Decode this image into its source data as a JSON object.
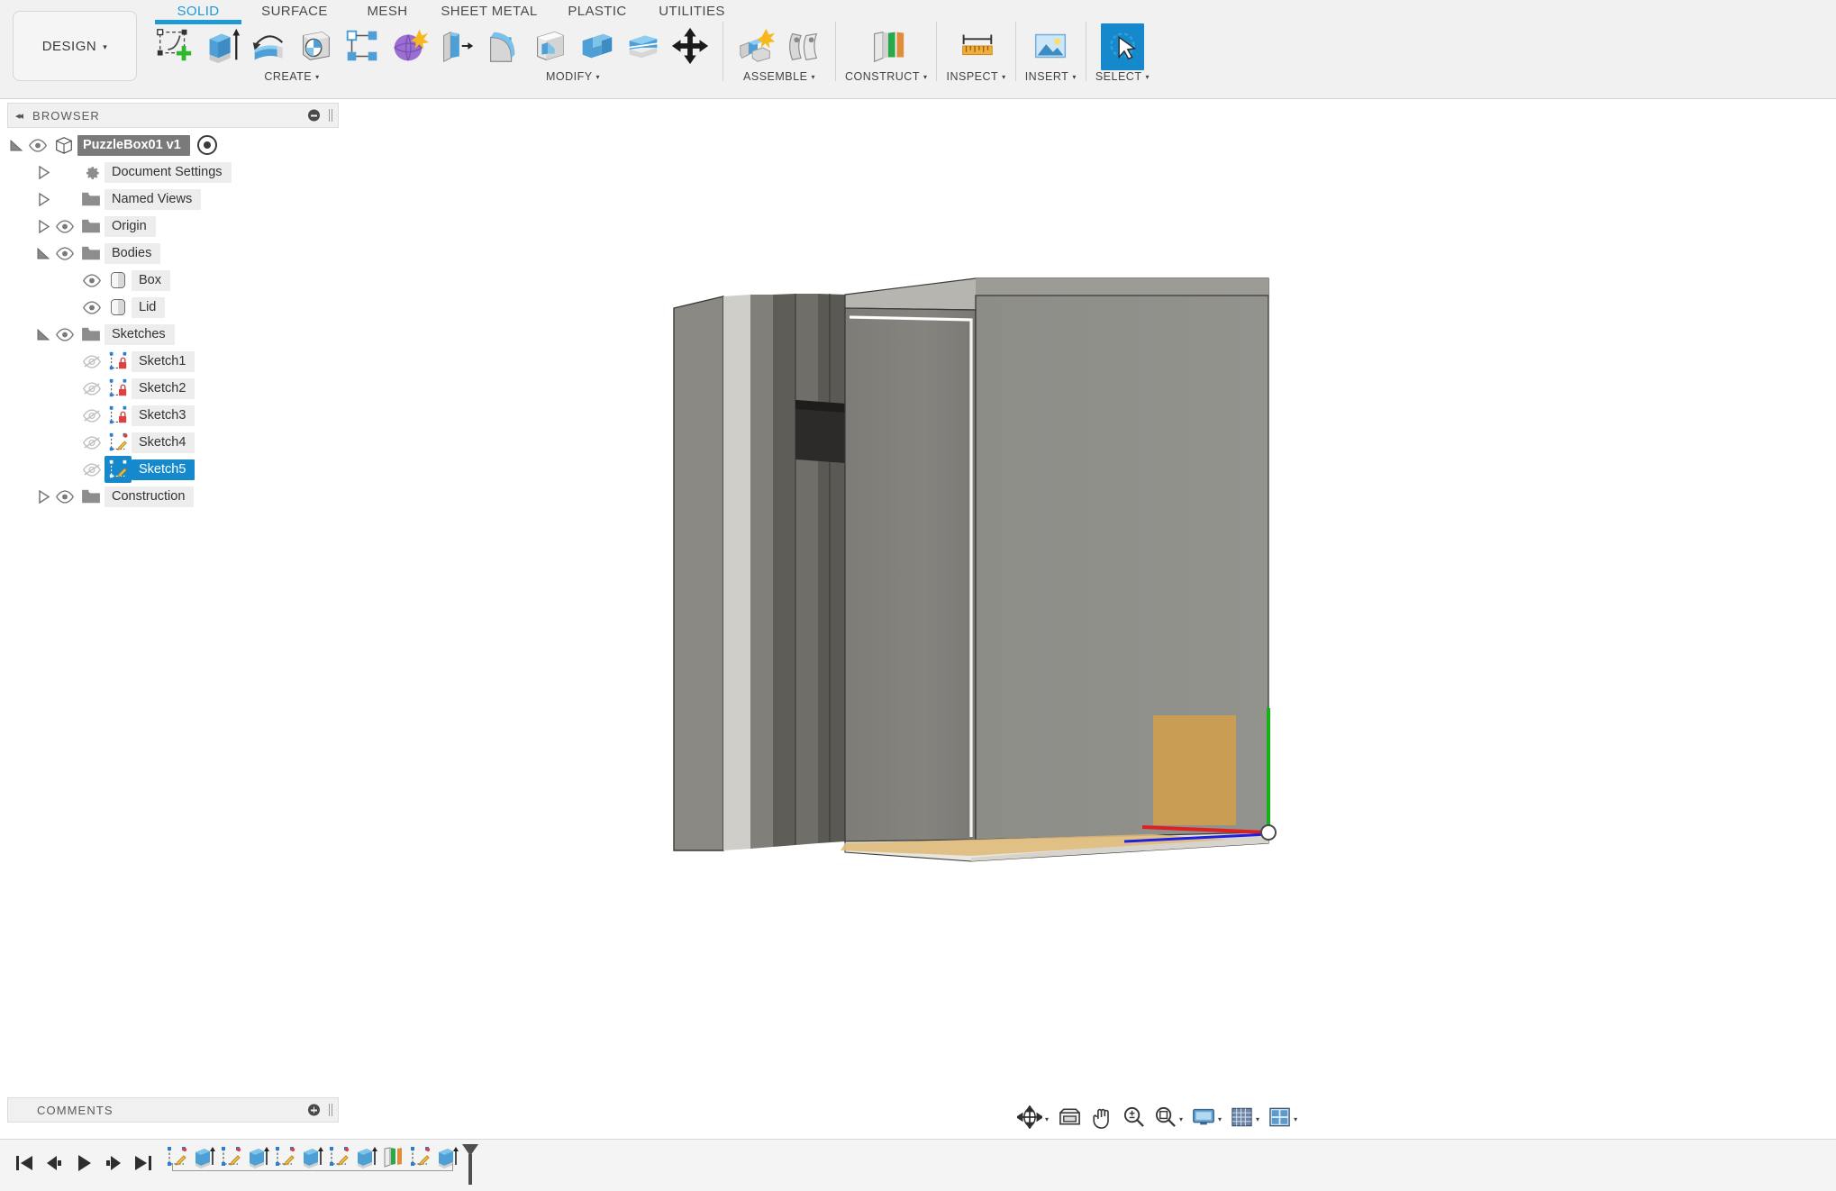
{
  "app": {
    "workspace_label": "DESIGN",
    "caret": "▾"
  },
  "ribbon": {
    "tabs": [
      {
        "label": "SOLID",
        "active": true
      },
      {
        "label": "SURFACE",
        "active": false
      },
      {
        "label": "MESH",
        "active": false
      },
      {
        "label": "SHEET METAL",
        "active": false
      },
      {
        "label": "PLASTIC",
        "active": false
      },
      {
        "label": "UTILITIES",
        "active": false
      }
    ],
    "groups": [
      {
        "label": "CREATE",
        "has_caret": true,
        "tools": [
          {
            "name": "create-sketch-icon",
            "title": "Create Sketch"
          },
          {
            "name": "extrude-icon",
            "title": "Extrude"
          },
          {
            "name": "revolve-icon",
            "title": "Revolve"
          },
          {
            "name": "sweep-icon",
            "title": "Sweep"
          },
          {
            "name": "pattern-icon",
            "title": "Pattern"
          },
          {
            "name": "form-icon",
            "title": "Create Form"
          }
        ]
      },
      {
        "label": "MODIFY",
        "has_caret": true,
        "tools": [
          {
            "name": "press-pull-icon",
            "title": "Press Pull"
          },
          {
            "name": "fillet-icon",
            "title": "Fillet"
          },
          {
            "name": "shell-icon",
            "title": "Shell"
          },
          {
            "name": "combine-icon",
            "title": "Combine"
          },
          {
            "name": "split-face-icon",
            "title": "Split Face"
          },
          {
            "name": "move-copy-icon",
            "title": "Move/Copy"
          }
        ]
      },
      {
        "label": "ASSEMBLE",
        "has_caret": true,
        "tools": [
          {
            "name": "new-component-icon",
            "title": "New Component"
          },
          {
            "name": "joint-icon",
            "title": "Joint"
          }
        ]
      },
      {
        "label": "CONSTRUCT",
        "has_caret": true,
        "tools": [
          {
            "name": "offset-plane-icon",
            "title": "Offset Plane"
          }
        ]
      },
      {
        "label": "INSPECT",
        "has_caret": true,
        "tools": [
          {
            "name": "measure-icon",
            "title": "Measure"
          }
        ]
      },
      {
        "label": "INSERT",
        "has_caret": true,
        "tools": [
          {
            "name": "insert-image-icon",
            "title": "Canvas"
          }
        ]
      },
      {
        "label": "SELECT",
        "has_caret": true,
        "tools": [
          {
            "name": "select-cursor-icon",
            "title": "Select",
            "selected": true
          }
        ]
      }
    ]
  },
  "browser": {
    "panel_title": "BROWSER",
    "collapse_icon": "◂◂",
    "tree": [
      {
        "label": "PuzzleBox01 v1",
        "level": 0,
        "type": "root",
        "arrow": "expanded",
        "eye": true,
        "icon": "component-icon",
        "radio": true
      },
      {
        "label": "Document Settings",
        "level": 1,
        "type": "settings",
        "arrow": "collapsed",
        "eye": false,
        "icon": "gear-icon"
      },
      {
        "label": "Named Views",
        "level": 1,
        "type": "folder",
        "arrow": "collapsed",
        "eye": false,
        "icon": "folder-icon"
      },
      {
        "label": "Origin",
        "level": 1,
        "type": "folder",
        "arrow": "collapsed",
        "eye": true,
        "icon": "folder-icon"
      },
      {
        "label": "Bodies",
        "level": 1,
        "type": "folder",
        "arrow": "expanded",
        "eye": true,
        "icon": "folder-icon"
      },
      {
        "label": "Box",
        "level": 2,
        "type": "body",
        "arrow": "none",
        "eye": true,
        "icon": "body-icon"
      },
      {
        "label": "Lid",
        "level": 2,
        "type": "body",
        "arrow": "none",
        "eye": true,
        "icon": "body-icon"
      },
      {
        "label": "Sketches",
        "level": 1,
        "type": "folder",
        "arrow": "expanded",
        "eye": true,
        "icon": "folder-icon"
      },
      {
        "label": "Sketch1",
        "level": 2,
        "type": "sketch",
        "arrow": "none",
        "eye": "hidden",
        "icon": "sketch-locked-icon"
      },
      {
        "label": "Sketch2",
        "level": 2,
        "type": "sketch",
        "arrow": "none",
        "eye": "hidden",
        "icon": "sketch-locked-icon"
      },
      {
        "label": "Sketch3",
        "level": 2,
        "type": "sketch",
        "arrow": "none",
        "eye": "hidden",
        "icon": "sketch-locked-icon"
      },
      {
        "label": "Sketch4",
        "level": 2,
        "type": "sketch",
        "arrow": "none",
        "eye": "hidden",
        "icon": "sketch-icon"
      },
      {
        "label": "Sketch5",
        "level": 2,
        "type": "sketch",
        "arrow": "none",
        "eye": "hidden",
        "icon": "sketch-icon",
        "selected": true
      },
      {
        "label": "Construction",
        "level": 1,
        "type": "folder",
        "arrow": "collapsed",
        "eye": true,
        "icon": "folder-icon"
      }
    ]
  },
  "comments": {
    "title": "COMMENTS"
  },
  "viewbar": {
    "tools": [
      {
        "name": "orbit-icon",
        "title": "Orbit",
        "caret": true
      },
      {
        "name": "look-at-icon",
        "title": "Look At",
        "caret": false
      },
      {
        "name": "pan-icon",
        "title": "Pan",
        "caret": false
      },
      {
        "name": "zoom-icon",
        "title": "Zoom",
        "caret": false
      },
      {
        "name": "zoom-fit-icon",
        "title": "Fit",
        "caret": true
      },
      {
        "name": "display-settings-icon",
        "title": "Display Settings",
        "caret": true
      },
      {
        "name": "grid-snap-icon",
        "title": "Grid and Snaps",
        "caret": true
      },
      {
        "name": "viewports-icon",
        "title": "Viewports",
        "caret": true
      }
    ]
  },
  "timeline": {
    "nav": [
      {
        "name": "timeline-go-start-button",
        "glyph": "start"
      },
      {
        "name": "timeline-step-back-button",
        "glyph": "stepback"
      },
      {
        "name": "timeline-play-button",
        "glyph": "play"
      },
      {
        "name": "timeline-step-forward-button",
        "glyph": "stepfwd"
      },
      {
        "name": "timeline-go-end-button",
        "glyph": "end"
      }
    ],
    "features": [
      {
        "name": "timeline-sketch-feature",
        "icon": "sketch-icon"
      },
      {
        "name": "timeline-extrude-feature",
        "icon": "extrude-icon"
      },
      {
        "name": "timeline-sketch-feature",
        "icon": "sketch-icon"
      },
      {
        "name": "timeline-extrude-feature",
        "icon": "extrude-icon"
      },
      {
        "name": "timeline-sketch-feature",
        "icon": "sketch-icon"
      },
      {
        "name": "timeline-extrude-feature",
        "icon": "extrude-icon"
      },
      {
        "name": "timeline-sketch-feature",
        "icon": "sketch-icon"
      },
      {
        "name": "timeline-extrude-feature",
        "icon": "extrude-icon"
      },
      {
        "name": "timeline-plane-feature",
        "icon": "offset-plane-icon"
      },
      {
        "name": "timeline-sketch-feature",
        "icon": "sketch-icon"
      },
      {
        "name": "timeline-extrude-feature",
        "icon": "extrude-icon"
      }
    ],
    "marker_name": "timeline-playhead-marker"
  },
  "model": {
    "description": "PuzzleBox01 solid body shaded grey with hinge slot on left edge and orange sketch profile at lower right",
    "colors": {
      "body_front": "#82807b",
      "body_right": "#8e8e89",
      "body_top": "#9b9b96",
      "sketch_profile": "#cf9e4f",
      "axis_x": "#e02020",
      "axis_y": "#12b312",
      "axis_z": "#2020e0",
      "selection_blue": "#1689cc"
    }
  }
}
